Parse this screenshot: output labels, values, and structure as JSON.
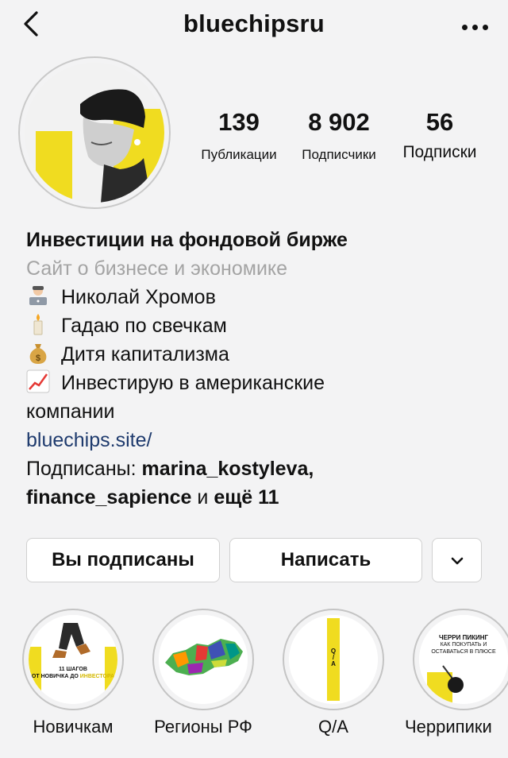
{
  "header": {
    "username": "bluechipsru"
  },
  "stats": [
    {
      "value": "139",
      "label": "Публикации"
    },
    {
      "value": "8 902",
      "label": "Подписчики"
    },
    {
      "value": "56",
      "label": "Подписки"
    }
  ],
  "bio": {
    "name": "Инвестиции на фондовой бирже",
    "category": "Сайт о бизнесе и экономике",
    "lines": [
      "Николай Хромов",
      "Гадаю по свечкам",
      "Дитя капитализма",
      "Инвестирую в американские",
      "компании"
    ],
    "link": "bluechips.site/",
    "followed_prefix": "Подписаны:",
    "followed_user1": "marina_kostyleva,",
    "followed_user2": "finance_sapience",
    "followed_and": "и",
    "followed_more": "ещё 11"
  },
  "buttons": {
    "following": "Вы подписаны",
    "message": "Написать"
  },
  "highlights": [
    {
      "label": "Новичкам",
      "cover_text_1": "11 ШАГОВ",
      "cover_text_2": "ОТ НОВИЧКА ДО",
      "cover_text_3": "ИНВЕСТОРА"
    },
    {
      "label": "Регионы РФ"
    },
    {
      "label": "Q/A",
      "cover_text_1": "Q",
      "cover_text_2": "/",
      "cover_text_3": "A"
    },
    {
      "label": "Черрипики",
      "cover_text_1": "ЧЕРРИ ПИКИНГ",
      "cover_text_2": "КАК ПОКУПАТЬ И",
      "cover_text_3": "ОСТАВАТЬСЯ В ПЛЮСЕ"
    }
  ],
  "colors": {
    "accent_yellow": "#f0dc20",
    "link_blue": "#1e3a6d",
    "muted_gray": "#a4a4a4",
    "background": "#f3f3f4"
  }
}
